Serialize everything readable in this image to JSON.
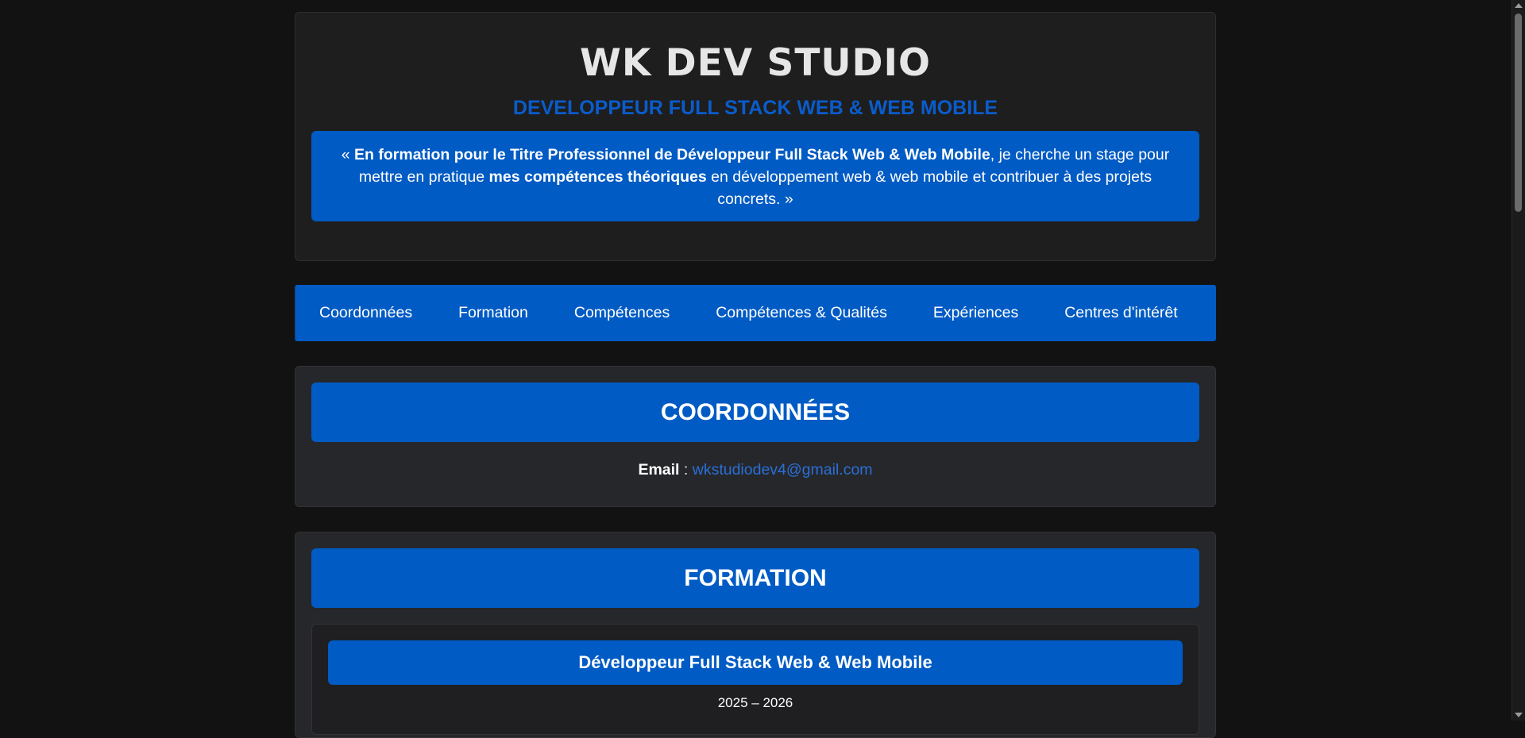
{
  "header": {
    "title": "WK DEV STUDIO",
    "subtitle": "DEVELOPPEUR FULL STACK WEB & WEB MOBILE",
    "quote": {
      "open": "« ",
      "bold1": "En formation pour le Titre Professionnel de Développeur Full Stack Web & Web Mobile",
      "text1": ", je cherche un stage pour mettre en pratique ",
      "bold2": "mes compétences théoriques",
      "text2": " en développement web & web mobile et contribuer à des projets concrets. »"
    }
  },
  "nav": {
    "items": [
      {
        "label": "Coordonnées"
      },
      {
        "label": "Formation"
      },
      {
        "label": "Compétences"
      },
      {
        "label": "Compétences & Qualités"
      },
      {
        "label": "Expériences"
      },
      {
        "label": "Centres d'intérêt"
      }
    ]
  },
  "coordonnees": {
    "title": "COORDONNÉES",
    "email_label": "Email",
    "email_sep": " : ",
    "email": "wkstudiodev4@gmail.com"
  },
  "formation": {
    "title": "FORMATION",
    "items": [
      {
        "title": "Développeur Full Stack Web & Web Mobile",
        "dates": "2025 – 2026"
      }
    ]
  },
  "colors": {
    "background": "#121212",
    "accent": "#005bc4",
    "card": "#1e1e1e"
  }
}
